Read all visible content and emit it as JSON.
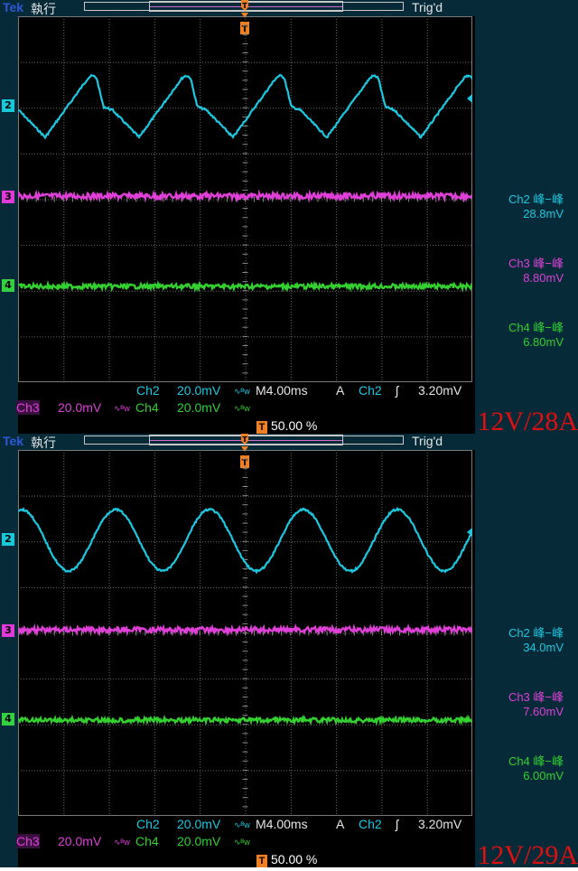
{
  "panels": [
    {
      "brand": "Tek",
      "run_state": "執行",
      "trigger_status": "Trig'd",
      "channel_markers": [
        "2",
        "3",
        "4"
      ],
      "trigger_marker": "T",
      "waveform_shape": "distorted-triangle",
      "measurements": [
        {
          "label": "Ch2 峰−峰",
          "value": "28.8mV",
          "color": "#1cc8e0"
        },
        {
          "label": "Ch3 峰−峰",
          "value": "8.80mV",
          "color": "#e040d8"
        },
        {
          "label": "Ch4 峰−峰",
          "value": "6.80mV",
          "color": "#33d030"
        }
      ],
      "status_row1": {
        "ch": "Ch2",
        "scale": "20.0mV",
        "bw": "∿ᴮw",
        "timebase": "M4.00ms",
        "trig_src_a": "A",
        "trig_ch": "Ch2",
        "edge": "ʃ",
        "trig_level": "3.20mV"
      },
      "status_row2": {
        "ch3": "Ch3",
        "ch3_scale": "20.0mV",
        "ch3_bw": "∿ᴮw",
        "ch4": "Ch4",
        "ch4_scale": "20.0mV",
        "ch4_bw": "∿ᴮw"
      },
      "trigger_position": "50.00 %",
      "condition_label": "12V/28A"
    },
    {
      "brand": "Tek",
      "run_state": "執行",
      "trigger_status": "Trig'd",
      "channel_markers": [
        "2",
        "3",
        "4"
      ],
      "trigger_marker": "T",
      "waveform_shape": "sine",
      "measurements": [
        {
          "label": "Ch2 峰−峰",
          "value": "34.0mV",
          "color": "#1cc8e0"
        },
        {
          "label": "Ch3 峰−峰",
          "value": "7.60mV",
          "color": "#e040d8"
        },
        {
          "label": "Ch4 峰−峰",
          "value": "6.00mV",
          "color": "#33d030"
        }
      ],
      "status_row1": {
        "ch": "Ch2",
        "scale": "20.0mV",
        "bw": "∿ᴮw",
        "timebase": "M4.00ms",
        "trig_src_a": "A",
        "trig_ch": "Ch2",
        "edge": "ʃ",
        "trig_level": "3.20mV"
      },
      "status_row2": {
        "ch3": "Ch3",
        "ch3_scale": "20.0mV",
        "ch3_bw": "∿ᴮw",
        "ch4": "Ch4",
        "ch4_scale": "20.0mV",
        "ch4_bw": "∿ᴮw"
      },
      "trigger_position": "50.00 %",
      "condition_label": "12V/29A"
    }
  ]
}
